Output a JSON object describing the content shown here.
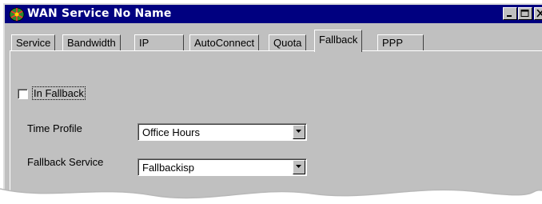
{
  "window": {
    "title": "WAN Service No Name"
  },
  "tabs": [
    {
      "label": "Service"
    },
    {
      "label": "Bandwidth"
    },
    {
      "label": "IP"
    },
    {
      "label": "AutoConnect"
    },
    {
      "label": "Quota"
    },
    {
      "label": "Fallback",
      "active": true
    },
    {
      "label": "PPP"
    }
  ],
  "fallback": {
    "in_fallback_label": "In Fallback",
    "in_fallback_checked": false,
    "time_profile_label": "Time Profile",
    "time_profile_value": "Office Hours",
    "fallback_service_label": "Fallback Service",
    "fallback_service_value": "Fallbackisp"
  },
  "colors": {
    "titlebar": "#000080",
    "face": "#c0c0c0"
  }
}
